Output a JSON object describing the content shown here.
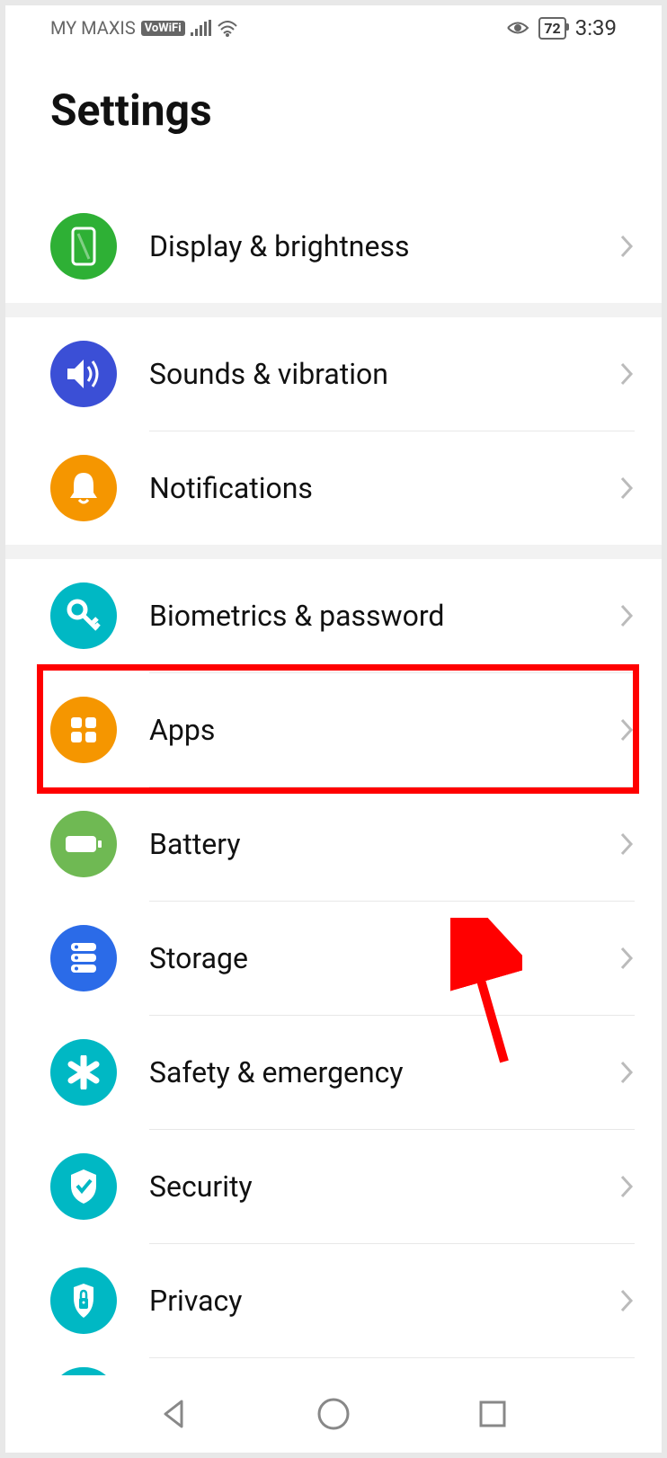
{
  "status_bar": {
    "carrier": "MY MAXIS",
    "vowifi": "VoWiFi",
    "battery": "72",
    "time": "3:39"
  },
  "header": {
    "title": "Settings"
  },
  "groups": [
    {
      "items": [
        {
          "id": "display",
          "label": "Display & brightness",
          "color": "#2eb035",
          "icon": "phone-icon"
        }
      ]
    },
    {
      "items": [
        {
          "id": "sounds",
          "label": "Sounds & vibration",
          "color": "#3b4fd6",
          "icon": "speaker-icon"
        },
        {
          "id": "notifications",
          "label": "Notifications",
          "color": "#f59600",
          "icon": "bell-icon"
        }
      ]
    },
    {
      "items": [
        {
          "id": "biometrics",
          "label": "Biometrics & password",
          "color": "#00b8c4",
          "icon": "key-icon"
        },
        {
          "id": "apps",
          "label": "Apps",
          "color": "#f59600",
          "icon": "grid-icon",
          "highlighted": true
        },
        {
          "id": "battery",
          "label": "Battery",
          "color": "#6fb953",
          "icon": "battery-icon"
        },
        {
          "id": "storage",
          "label": "Storage",
          "color": "#2b6be8",
          "icon": "storage-icon"
        },
        {
          "id": "safety",
          "label": "Safety & emergency",
          "color": "#00b8c4",
          "icon": "asterisk-icon"
        },
        {
          "id": "security",
          "label": "Security",
          "color": "#00b8c4",
          "icon": "shield-icon"
        },
        {
          "id": "privacy",
          "label": "Privacy",
          "color": "#00b8c4",
          "icon": "lock-icon"
        }
      ]
    }
  ]
}
